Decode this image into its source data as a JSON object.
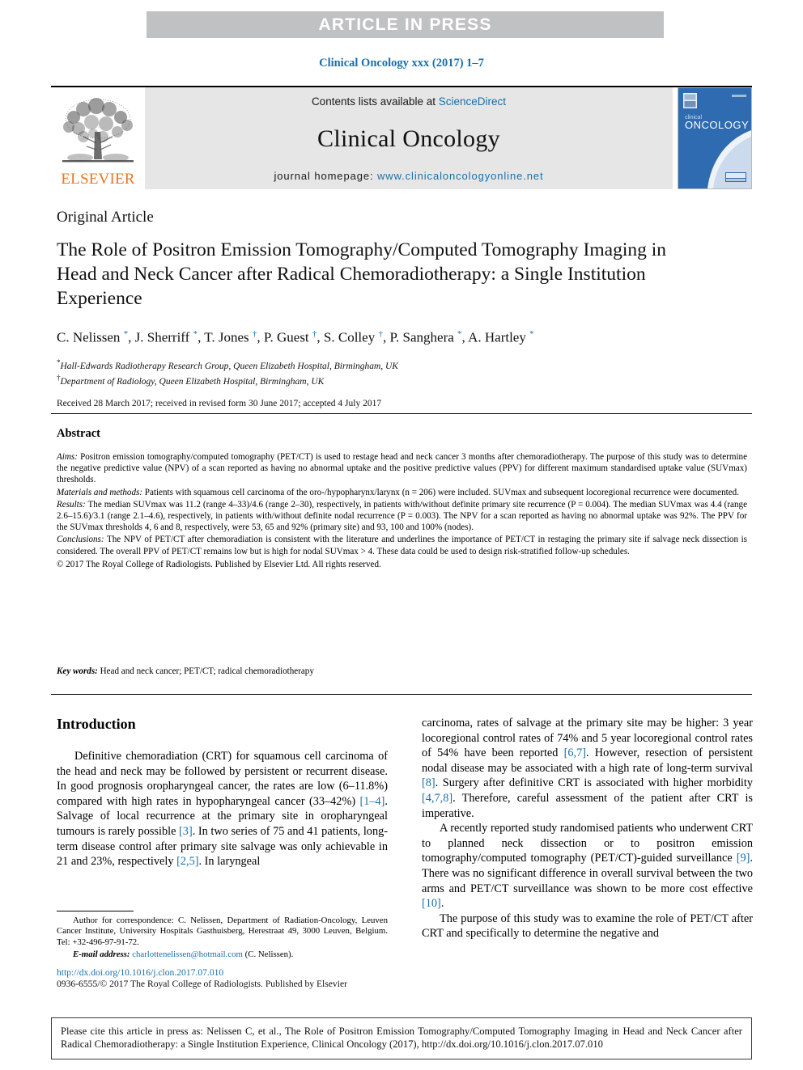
{
  "banner": {
    "text": "ARTICLE IN PRESS"
  },
  "journal_line": "Clinical Oncology xxx (2017) 1–7",
  "masthead": {
    "publisher": "ELSEVIER",
    "contents_prefix": "Contents lists available at ",
    "contents_link": "ScienceDirect",
    "journal_title": "Clinical Oncology",
    "homepage_label": "journal homepage:",
    "homepage_url": "www.clinicaloncologyonline.net",
    "cover_title_line1": "clinical",
    "cover_title_line2": "ONCOLOGY"
  },
  "article": {
    "type": "Original Article",
    "title": "The Role of Positron Emission Tomography/Computed Tomography Imaging in Head and Neck Cancer after Radical Chemoradiotherapy: a Single Institution Experience",
    "authors_html": "C. Nelissen <sup>*</sup>, J. Sherriff <sup>*</sup>, T. Jones <sup>†</sup>, P. Guest <sup>†</sup>, S. Colley <sup>†</sup>, P. Sanghera <sup>*</sup>, A. Hartley <sup>*</sup>",
    "affiliation_1": "Hall-Edwards Radiotherapy Research Group, Queen Elizabeth Hospital, Birmingham, UK",
    "affiliation_2": "Department of Radiology, Queen Elizabeth Hospital, Birmingham, UK",
    "dates": "Received 28 March 2017; received in revised form 30 June 2017; accepted 4 July 2017"
  },
  "abstract": {
    "heading": "Abstract",
    "aims_label": "Aims:",
    "aims_text": " Positron emission tomography/computed tomography (PET/CT) is used to restage head and neck cancer 3 months after chemoradiotherapy. The purpose of this study was to determine the negative predictive value (NPV) of a scan reported as having no abnormal uptake and the positive predictive values (PPV) for different maximum standardised uptake value (SUVmax) thresholds.",
    "methods_label": "Materials and methods:",
    "methods_text": " Patients with squamous cell carcinoma of the oro-/hypopharynx/larynx (n = 206) were included. SUVmax and subsequent locoregional recurrence were documented.",
    "results_label": "Results:",
    "results_text": " The median SUVmax was 11.2 (range 4–33)/4.6 (range 2–30), respectively, in patients with/without definite primary site recurrence (P = 0.004). The median SUVmax was 4.4 (range 2.6–15.6)/3.1 (range 2.1–4.6), respectively, in patients with/without definite nodal recurrence (P = 0.003). The NPV for a scan reported as having no abnormal uptake was 92%. The PPV for the SUVmax thresholds 4, 6 and 8, respectively, were 53, 65 and 92% (primary site) and 93, 100 and 100% (nodes).",
    "conclusions_label": "Conclusions:",
    "conclusions_text": " The NPV of PET/CT after chemoradiation is consistent with the literature and underlines the importance of PET/CT in restaging the primary site if salvage neck dissection is considered. The overall PPV of PET/CT remains low but is high for nodal SUVmax > 4. These data could be used to design risk-stratified follow-up schedules.",
    "copyright": "© 2017 The Royal College of Radiologists. Published by Elsevier Ltd. All rights reserved.",
    "keywords_label": "Key words:",
    "keywords_text": " Head and neck cancer; PET/CT; radical chemoradiotherapy"
  },
  "introduction": {
    "heading": "Introduction",
    "left_p1_a": "Definitive chemoradiation (CRT) for squamous cell carcinoma of the head and neck may be followed by persistent or recurrent disease. In good prognosis oropharyngeal cancer, the rates are low (6–11.8%) compared with high rates in hypopharyngeal cancer (33–42%) ",
    "left_ref1": "[1–4]",
    "left_p1_b": ". Salvage of local recurrence at the primary site in oropharyngeal tumours is rarely possible ",
    "left_ref2": "[3]",
    "left_p1_c": ". In two series of 75 and 41 patients, long-term disease control after primary site salvage was only achievable in 21 and 23%, respectively ",
    "left_ref3": "[2,5]",
    "left_p1_d": ". In laryngeal",
    "right_p1_a": "carcinoma, rates of salvage at the primary site may be higher: 3 year locoregional control rates of 74% and 5 year locoregional control rates of 54% have been reported ",
    "right_ref1": "[6,7]",
    "right_p1_b": ". However, resection of persistent nodal disease may be associated with a high rate of long-term survival ",
    "right_ref2": "[8]",
    "right_p1_c": ". Surgery after definitive CRT is associated with higher morbidity ",
    "right_ref3": "[4,7,8]",
    "right_p1_d": ". Therefore, careful assessment of the patient after CRT is imperative.",
    "right_p2_a": "A recently reported study randomised patients who underwent CRT to planned neck dissection or to positron emission tomography/computed tomography (PET/CT)-guided surveillance ",
    "right_ref4": "[9]",
    "right_p2_b": ". There was no significant difference in overall survival between the two arms and PET/CT surveillance was shown to be more cost effective ",
    "right_ref5": "[10]",
    "right_p2_c": ".",
    "right_p3": "The purpose of this study was to examine the role of PET/CT after CRT and specifically to determine the negative and"
  },
  "footnotes": {
    "correspondence": "Author for correspondence: C. Nelissen, Department of Radiation-Oncology, Leuven Cancer Institute, University Hospitals Gasthuisberg, Herestraat 49, 3000 Leuven, Belgium. Tel: +32-496-97-91-72.",
    "email_label": "E-mail address:",
    "email_address": "charlottenelissen@hotmail.com",
    "email_suffix": " (C. Nelissen).",
    "doi_url": "http://dx.doi.org/10.1016/j.clon.2017.07.010",
    "issn_line": "0936-6555/© 2017 The Royal College of Radiologists. Published by Elsevier"
  },
  "citation_box": {
    "text": "Please cite this article in press as: Nelissen C, et al., The Role of Positron Emission Tomography/Computed Tomography Imaging in Head and Neck Cancer after Radical Chemoradiotherapy: a Single Institution Experience, Clinical Oncology (2017), http://dx.doi.org/10.1016/j.clon.2017.07.010"
  },
  "colors": {
    "link": "#1a6fa8",
    "banner_bg": "#c0c1c3",
    "masthead_bg": "#e6e6e6",
    "elsevier_orange": "#e87722",
    "cover_blue": "#2f6bb0"
  }
}
